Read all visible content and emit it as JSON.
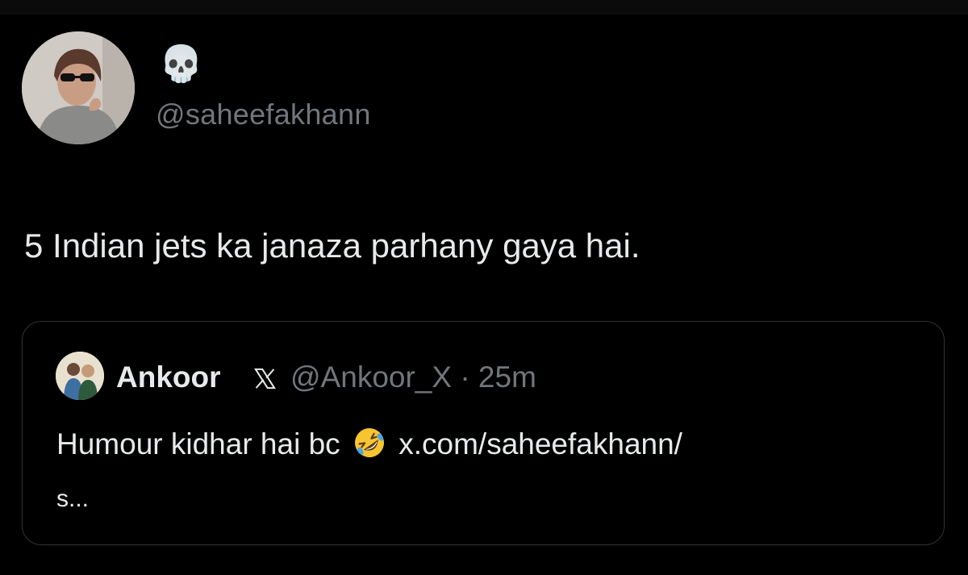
{
  "tweet": {
    "author_display_name": "💀",
    "author_handle": "@saheefakhann",
    "text": "5 Indian jets ka janaza parhany gaya hai."
  },
  "quote": {
    "author_name": "Ankoor",
    "author_handle_time": "@Ankoor_X · 25m",
    "text_before_emoji": "Humour kidhar hai bc",
    "emoji": "rolling-on-floor-laughing",
    "link_text": "x.com/saheefakhann/",
    "link_continuation": "s..."
  },
  "icons": {
    "x_logo": "x-logo-icon"
  },
  "colors": {
    "background": "#000000",
    "text_primary": "#e7e9ea",
    "text_secondary": "#71767b",
    "card_border": "#2f3336"
  }
}
